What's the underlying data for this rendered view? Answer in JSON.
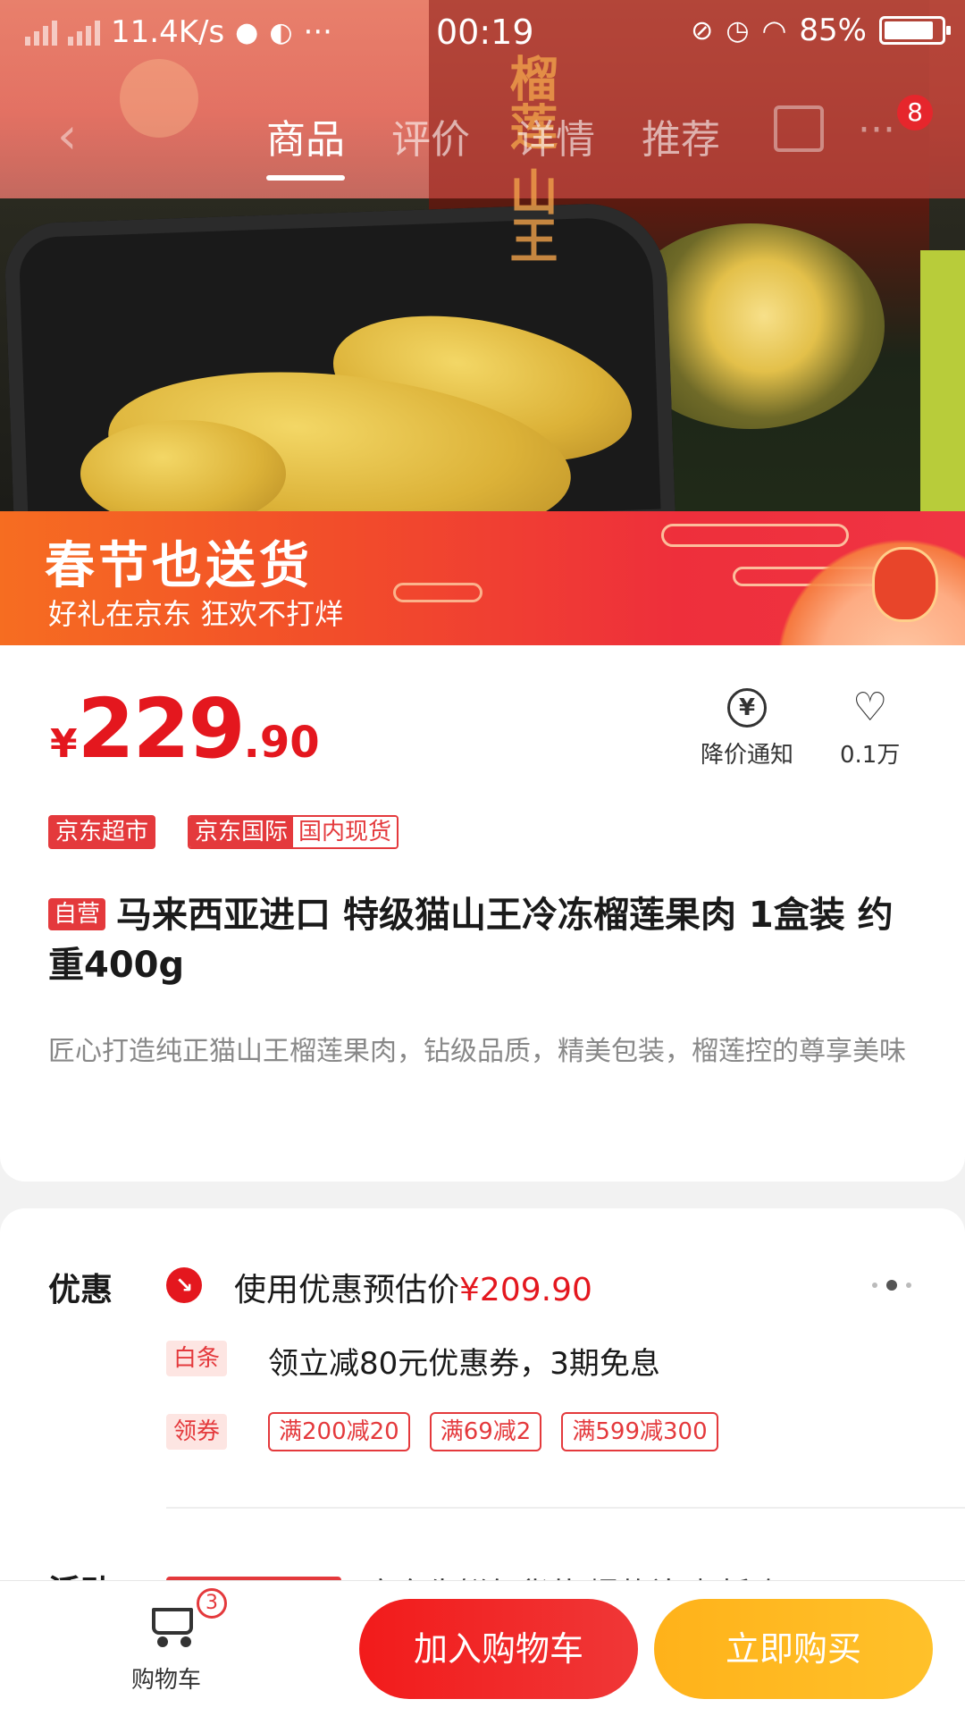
{
  "status_bar": {
    "net_speed": "11.4K/s",
    "more": "···",
    "time": "00:19",
    "battery": "85%"
  },
  "nav": {
    "back_icon": "chevron-left-icon",
    "tabs": [
      {
        "label": "商品",
        "active": true
      },
      {
        "label": "评价",
        "active": false
      },
      {
        "label": "详情",
        "active": false
      },
      {
        "label": "推荐",
        "active": false
      }
    ],
    "badge": "8"
  },
  "hero": {
    "overlay_text": "榴莲 山王"
  },
  "promo": {
    "title": "春节也送货",
    "subtitle": "好礼在京东 狂欢不打烊"
  },
  "product": {
    "price_symbol": "¥",
    "price_int": "229",
    "price_dec": ".90",
    "actions": [
      {
        "label": "降价通知",
        "icon": "price-drop-icon",
        "glyph": "¥"
      },
      {
        "label": "0.1万",
        "icon": "heart-plus-icon",
        "glyph": "♡"
      }
    ],
    "tags": {
      "supermarket": "京东超市",
      "intl_a": "京东国际",
      "intl_b": "国内现货"
    },
    "self_tag": "自营",
    "title": "马来西亚进口 特级猫山王冷冻榴莲果肉 1盒装 约重400g",
    "description": "匠心打造纯正猫山王榴莲果肉，钻级品质，精美包装，榴莲控的尊享美味"
  },
  "offers": {
    "label": "优惠",
    "estimate_text": "使用优惠预估价",
    "estimate_price": "¥209.90",
    "baitiao_tag": "白条",
    "baitiao_text": "领立减80元优惠券，3期免息",
    "coupon_tag": "领券",
    "coupons": [
      "满200减20",
      "满69减2",
      "满599减300"
    ],
    "activity_label": "活动",
    "activity_text": "京东生鲜年货节 爆款补贴 折购"
  },
  "bottom": {
    "cart_label": "购物车",
    "cart_count": "3",
    "add_to_cart": "加入购物车",
    "buy_now": "立即购买"
  },
  "colors": {
    "brand_red": "#e4171e",
    "buy_yellow": "#ffb21a"
  }
}
